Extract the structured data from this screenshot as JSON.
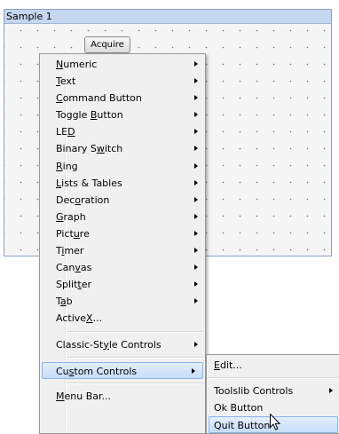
{
  "panel": {
    "title": "Sample 1",
    "acquire_label": "Acquire"
  },
  "menu": {
    "items": [
      {
        "pre": "",
        "ul": "N",
        "post": "umeric",
        "submenu": true
      },
      {
        "pre": "",
        "ul": "T",
        "post": "ext",
        "submenu": true
      },
      {
        "pre": "",
        "ul": "C",
        "post": "ommand Button",
        "submenu": true
      },
      {
        "pre": "Toggle ",
        "ul": "B",
        "post": "utton",
        "submenu": true
      },
      {
        "pre": "LE",
        "ul": "D",
        "post": "",
        "submenu": true
      },
      {
        "pre": "Binary S",
        "ul": "w",
        "post": "itch",
        "submenu": true
      },
      {
        "pre": "",
        "ul": "R",
        "post": "ing",
        "submenu": true
      },
      {
        "pre": "",
        "ul": "L",
        "post": "ists & Tables",
        "submenu": true
      },
      {
        "pre": "Dec",
        "ul": "o",
        "post": "ration",
        "submenu": true
      },
      {
        "pre": "",
        "ul": "G",
        "post": "raph",
        "submenu": true
      },
      {
        "pre": "Pict",
        "ul": "u",
        "post": "re",
        "submenu": true
      },
      {
        "pre": "T",
        "ul": "i",
        "post": "mer",
        "submenu": true
      },
      {
        "pre": "Can",
        "ul": "v",
        "post": "as",
        "submenu": true
      },
      {
        "pre": "Split",
        "ul": "t",
        "post": "er",
        "submenu": true
      },
      {
        "pre": "T",
        "ul": "a",
        "post": "b",
        "submenu": true
      },
      {
        "pre": "Active",
        "ul": "X",
        "post": "...",
        "submenu": false
      },
      {
        "pre": "Classic-St",
        "ul": "y",
        "post": "le Controls",
        "submenu": true
      },
      {
        "pre": "Cu",
        "ul": "s",
        "post": "tom Controls",
        "submenu": true
      },
      {
        "pre": "",
        "ul": "M",
        "post": "enu Bar...",
        "submenu": false
      }
    ]
  },
  "submenu": {
    "items": [
      {
        "pre": "",
        "ul": "E",
        "post": "dit...",
        "submenu": false
      },
      {
        "pre": "Toolslib Controls",
        "ul": "",
        "post": "",
        "submenu": true
      },
      {
        "pre": "Ok Button",
        "ul": "",
        "post": "",
        "submenu": false
      },
      {
        "pre": "Quit Button",
        "ul": "",
        "post": "",
        "submenu": false
      }
    ]
  },
  "colors": {
    "highlight": "#c6dcf8",
    "panel_title_bg": "#c4d7ef"
  }
}
